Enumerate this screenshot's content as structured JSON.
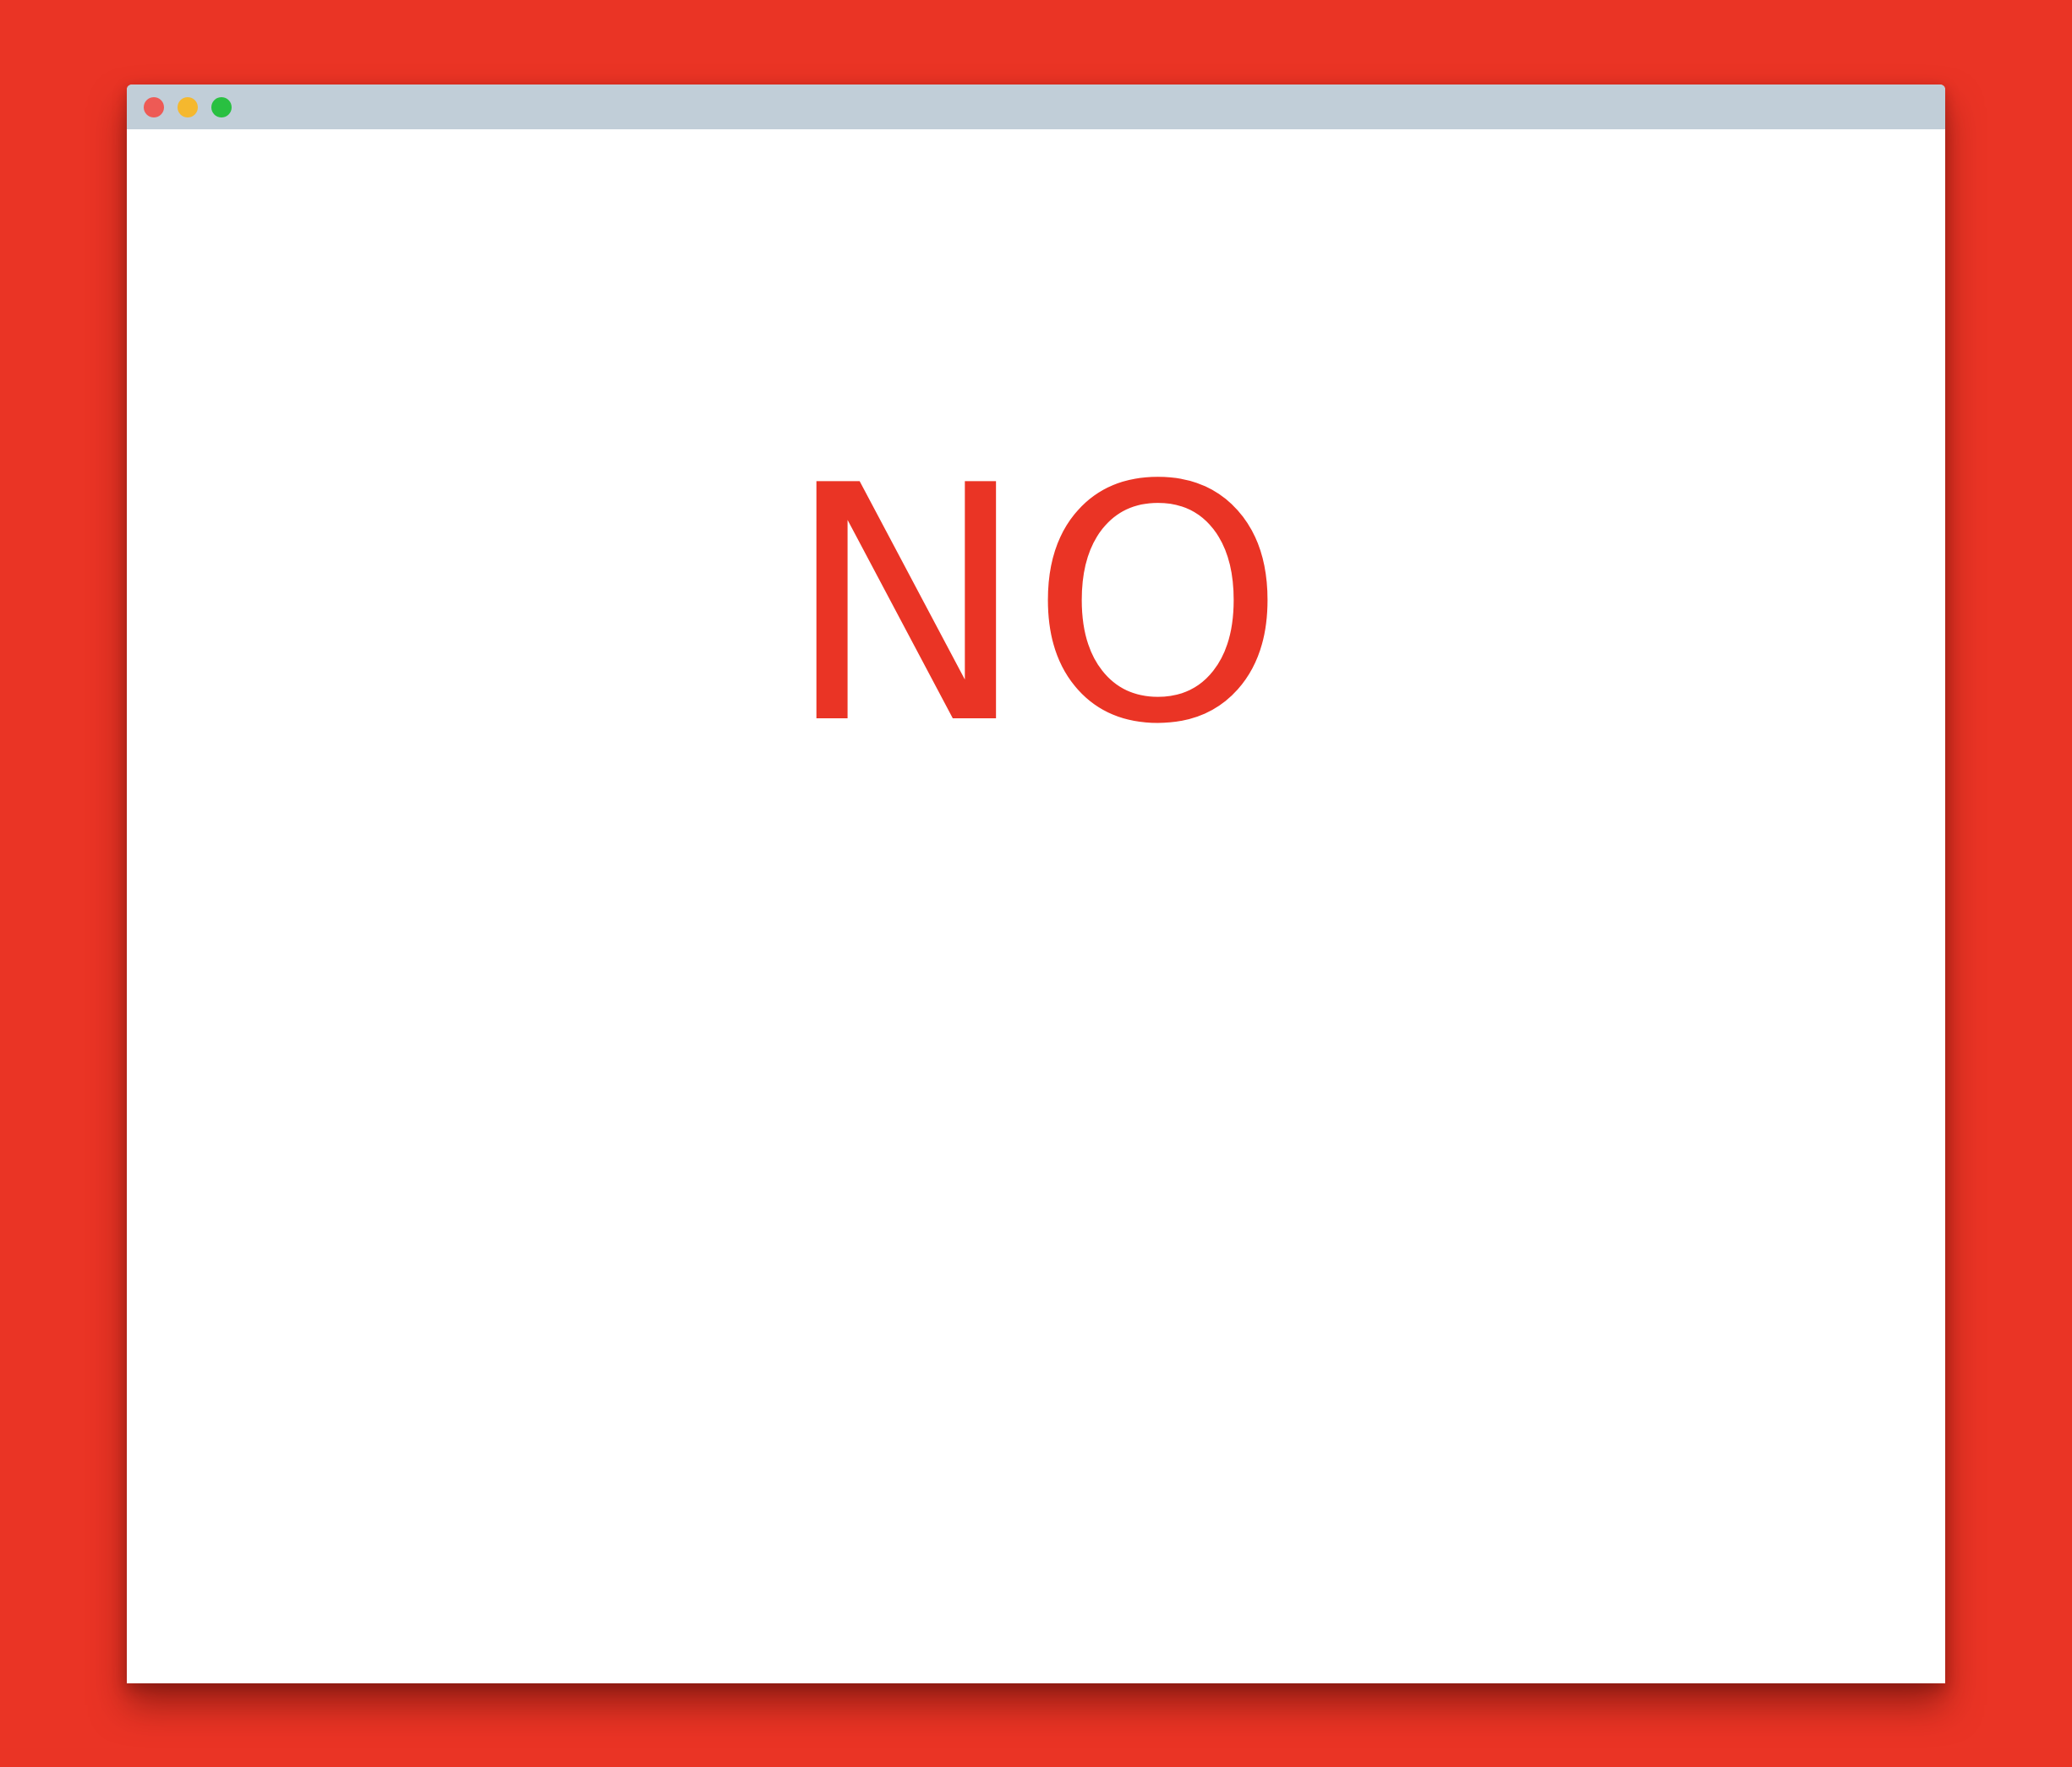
{
  "colors": {
    "background": "#EA3425",
    "titlebar": "#C1CED8",
    "close": "#EE5A55",
    "minimize": "#F5B82E",
    "maximize": "#29C041",
    "message": "#EA3425"
  },
  "window": {
    "controls": [
      "close-icon",
      "minimize-icon",
      "maximize-icon"
    ]
  },
  "content": {
    "message": "NO"
  }
}
